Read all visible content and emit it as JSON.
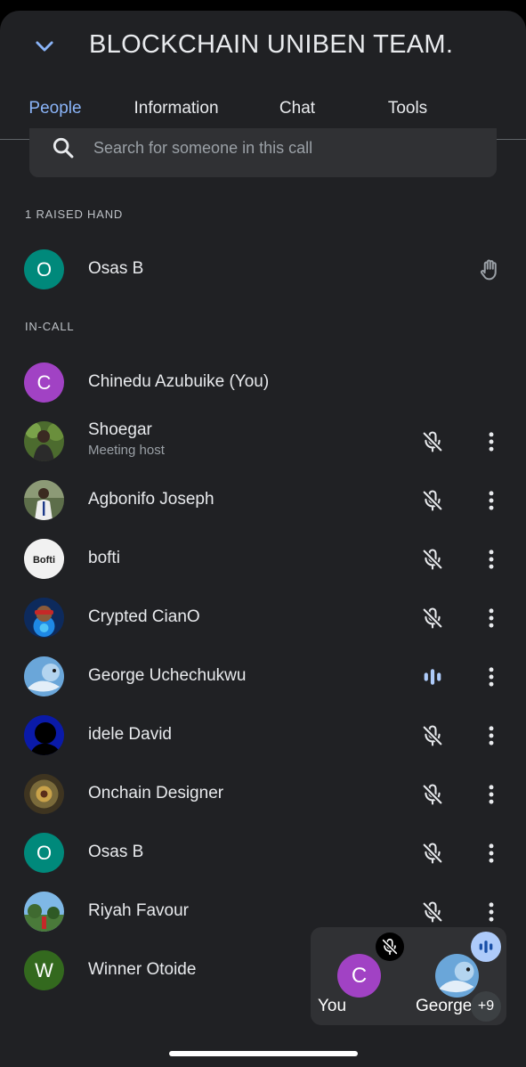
{
  "header": {
    "title": "BLOCKCHAIN UNIBEN TEAM.",
    "back_icon": "chevron-down-icon"
  },
  "tabs": [
    {
      "label": "People",
      "active": true
    },
    {
      "label": "Information",
      "active": false
    },
    {
      "label": "Chat",
      "active": false
    },
    {
      "label": "Tools",
      "active": false
    }
  ],
  "search": {
    "placeholder": "Search for someone in this call",
    "value": ""
  },
  "raised_hand": {
    "label": "1 RAISED HAND",
    "people": [
      {
        "name": "Osas B",
        "initial": "O",
        "avatar_color": "#00897b",
        "icon": "raised-hand-icon"
      }
    ]
  },
  "in_call": {
    "label": "IN-CALL",
    "people": [
      {
        "name": "Chinedu Azubuike (You)",
        "initial": "C",
        "avatar_color": "#a142c4",
        "subtext": "",
        "mic": "none"
      },
      {
        "name": "Shoegar",
        "subtext": "Meeting host",
        "avatar": "photo",
        "mic": "muted"
      },
      {
        "name": "Agbonifo Joseph",
        "subtext": "",
        "avatar": "photo",
        "mic": "muted"
      },
      {
        "name": "bofti",
        "subtext": "",
        "avatar": "logo",
        "avatar_text": "Bofti",
        "mic": "muted"
      },
      {
        "name": "Crypted CianO",
        "subtext": "",
        "avatar": "photo",
        "mic": "muted"
      },
      {
        "name": "George Uchechukwu",
        "subtext": "",
        "avatar": "photo",
        "mic": "speaking"
      },
      {
        "name": "idele David",
        "subtext": "",
        "avatar": "photo",
        "mic": "muted"
      },
      {
        "name": "Onchain Designer",
        "subtext": "",
        "avatar": "photo",
        "mic": "muted"
      },
      {
        "name": "Osas B",
        "initial": "O",
        "avatar_color": "#00897b",
        "subtext": "",
        "mic": "muted"
      },
      {
        "name": "Riyah Favour",
        "subtext": "",
        "avatar": "photo",
        "mic": "muted"
      },
      {
        "name": "Winner Otoide",
        "initial": "W",
        "avatar_color": "#33691e",
        "subtext": "",
        "mic": "none"
      }
    ]
  },
  "self_tile": {
    "you_label": "You",
    "you_initial": "C",
    "george_label": "George",
    "more_count": "+9"
  },
  "colors": {
    "background": "#202124",
    "accent": "#8ab4f8",
    "speaking": "#aecbfa"
  }
}
